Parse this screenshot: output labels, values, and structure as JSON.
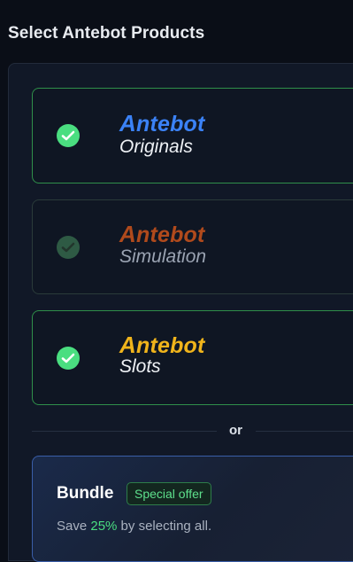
{
  "page": {
    "title": "Select Antebot Products"
  },
  "products": [
    {
      "brand_a": "A",
      "brand_rest": "ntebot",
      "name": "Originals",
      "selected": true,
      "brand_color": "#3b82f6",
      "brand_shade": "#2b5ec4"
    },
    {
      "brand_a": "A",
      "brand_rest": "ntebot",
      "name": "Simulation",
      "selected": true,
      "brand_color": "#b04a1c",
      "brand_shade": "#7e3412"
    },
    {
      "brand_a": "A",
      "brand_rest": "ntebot",
      "name": "Slots",
      "selected": true,
      "brand_color": "#f0b41b",
      "brand_shade": "#c28a0a"
    }
  ],
  "divider": {
    "label": "or"
  },
  "bundle": {
    "title": "Bundle",
    "badge": "Special offer",
    "desc_prefix": "Save ",
    "desc_percent": "25%",
    "desc_suffix": " by selecting all."
  },
  "colors": {
    "success": "#4ade80",
    "background": "#0a0e17",
    "panel": "#111827"
  }
}
